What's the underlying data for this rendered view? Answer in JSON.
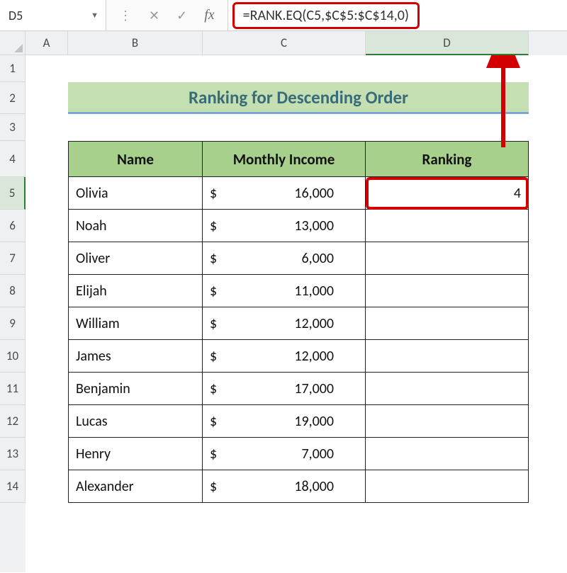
{
  "name_box": {
    "value": "D5"
  },
  "formula_bar": {
    "formula": "=RANK.EQ(C5,$C$5:$C$14,0)"
  },
  "columns": {
    "A": "A",
    "B": "B",
    "C": "C",
    "D": "D"
  },
  "rows": [
    "1",
    "2",
    "3",
    "4",
    "5",
    "6",
    "7",
    "8",
    "9",
    "10",
    "11",
    "12",
    "13",
    "14"
  ],
  "title": "Ranking for Descending Order",
  "table": {
    "headers": {
      "name": "Name",
      "income": "Monthly Income",
      "rank": "Ranking"
    },
    "rows": [
      {
        "name": "Olivia",
        "currency": "$",
        "income": "16,000",
        "rank": "4"
      },
      {
        "name": "Noah",
        "currency": "$",
        "income": "13,000",
        "rank": ""
      },
      {
        "name": "Oliver",
        "currency": "$",
        "income": "6,000",
        "rank": ""
      },
      {
        "name": "Elijah",
        "currency": "$",
        "income": "11,000",
        "rank": ""
      },
      {
        "name": "William",
        "currency": "$",
        "income": "12,000",
        "rank": ""
      },
      {
        "name": "James",
        "currency": "$",
        "income": "12,000",
        "rank": ""
      },
      {
        "name": "Benjamin",
        "currency": "$",
        "income": "17,000",
        "rank": ""
      },
      {
        "name": "Lucas",
        "currency": "$",
        "income": "19,000",
        "rank": ""
      },
      {
        "name": "Henry",
        "currency": "$",
        "income": "7,000",
        "rank": ""
      },
      {
        "name": "Alexander",
        "currency": "$",
        "income": "18,000",
        "rank": ""
      }
    ]
  }
}
